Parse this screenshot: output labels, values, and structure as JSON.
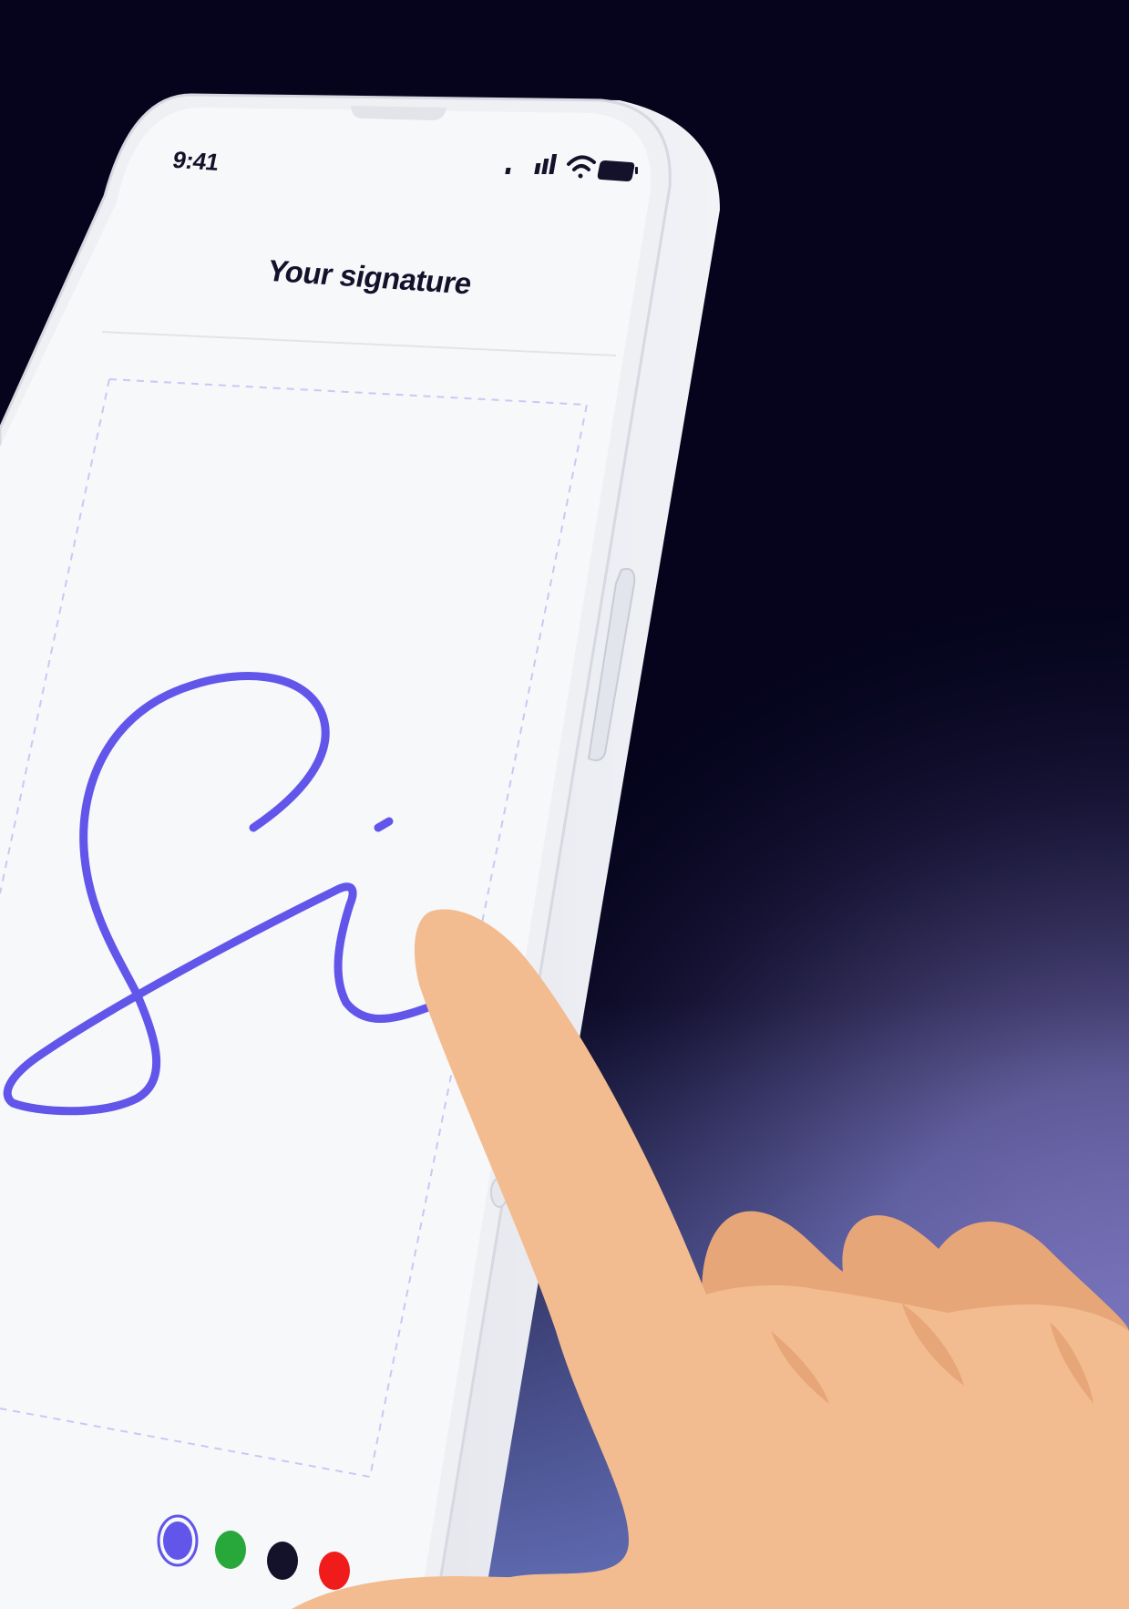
{
  "status_bar": {
    "time": "9:41",
    "icons": [
      "cellular-signal-icon",
      "wifi-icon",
      "battery-icon"
    ]
  },
  "screen": {
    "title": "Your signature"
  },
  "signature": {
    "stroke_color": "#6256ea"
  },
  "color_palette": {
    "options": [
      {
        "name": "purple",
        "color": "#6256ea",
        "selected": true
      },
      {
        "name": "green",
        "color": "#28a83b",
        "selected": false
      },
      {
        "name": "black",
        "color": "#14122b",
        "selected": false
      },
      {
        "name": "red",
        "color": "#f01c1c",
        "selected": false
      }
    ]
  },
  "colors": {
    "background_dark": "#05041c",
    "background_glow": "#8a74b8",
    "phone_frame": "#eef0f4",
    "screen_background": "#f7f8fa",
    "signature_box_border": "#c9c8f5",
    "hand_skin": "#f3bc90",
    "hand_shadow": "#e6a678"
  }
}
